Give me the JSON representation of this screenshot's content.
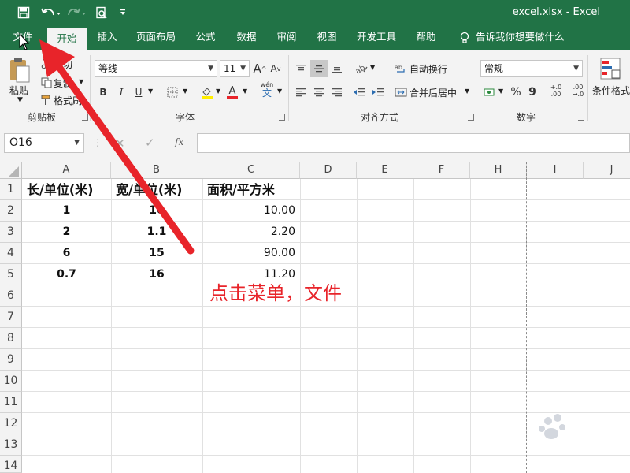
{
  "window": {
    "title": "excel.xlsx  -  Excel",
    "brand_color": "#217346"
  },
  "quick_access": {
    "save_icon": "save-icon",
    "undo_icon": "undo-icon",
    "redo_icon": "redo-icon",
    "preview_icon": "print-preview-icon",
    "customize_icon": "customize-icon"
  },
  "ribbon_tabs": [
    {
      "label": "文件"
    },
    {
      "label": "开始"
    },
    {
      "label": "插入"
    },
    {
      "label": "页面布局"
    },
    {
      "label": "公式"
    },
    {
      "label": "数据"
    },
    {
      "label": "审阅"
    },
    {
      "label": "视图"
    },
    {
      "label": "开发工具"
    },
    {
      "label": "帮助"
    }
  ],
  "tell_me": {
    "label": "告诉我你想要做什么",
    "icon": "lightbulb-icon"
  },
  "ribbon": {
    "clipboard": {
      "group": "剪贴板",
      "paste": "粘贴",
      "cut": "剪切",
      "copy": "复制",
      "format_painter": "格式刷"
    },
    "font": {
      "group": "字体",
      "font_name": "等线",
      "font_size": "11",
      "bold": "B",
      "italic": "I",
      "underline": "U",
      "grow": "A",
      "shrink": "A",
      "wen": "wén",
      "wen_char": "文"
    },
    "alignment": {
      "group": "对齐方式",
      "wrap_text": "自动换行",
      "merge_center": "合并后居中"
    },
    "number": {
      "group": "数字",
      "format": "常规",
      "percent": "%",
      "comma": "9",
      "inc_decimal": "+.0 .00",
      "dec_decimal": ".00 →.0"
    },
    "styles": {
      "conditional_format": "条件格式"
    }
  },
  "formula_bar": {
    "name_box": "O16",
    "fx_label": "fx",
    "value": ""
  },
  "sheet": {
    "columns": [
      "A",
      "B",
      "C",
      "D",
      "E",
      "F",
      "H",
      "I",
      "J"
    ],
    "rows": [
      "1",
      "2",
      "3",
      "4",
      "5",
      "6",
      "7",
      "8",
      "9",
      "10",
      "11",
      "12",
      "13",
      "14"
    ],
    "headers": [
      "长/单位(米)",
      "宽/单位(米)",
      "面积/平方米"
    ],
    "data": [
      [
        "1",
        "10",
        "10.00"
      ],
      [
        "2",
        "1.1",
        "2.20"
      ],
      [
        "6",
        "15",
        "90.00"
      ],
      [
        "0.7",
        "16",
        "11.20"
      ]
    ]
  },
  "annotation": {
    "text": "点击菜单，文件",
    "color": "#e8242a"
  }
}
